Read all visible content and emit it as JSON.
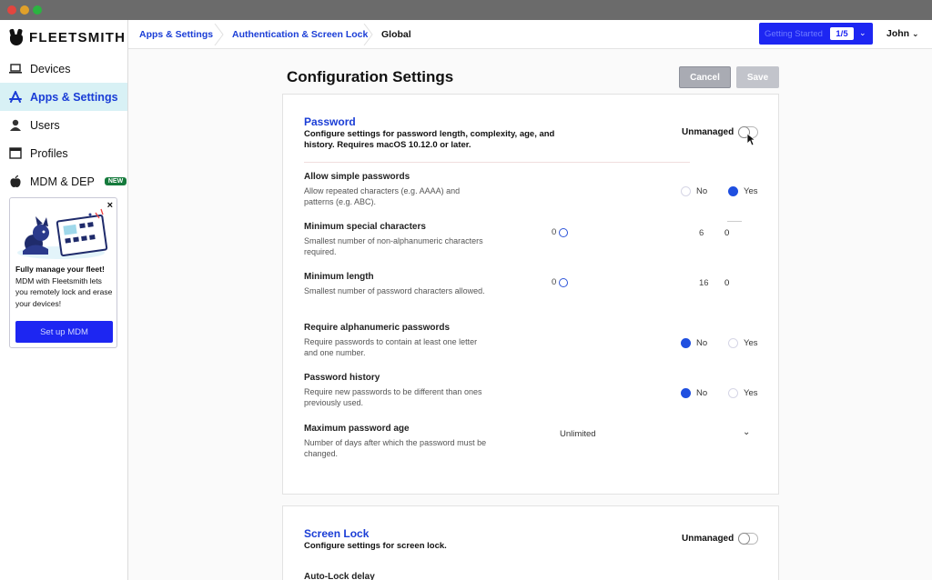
{
  "app": {
    "brand": "FLEETSMITH"
  },
  "sidebar": {
    "items": [
      {
        "label": "Devices",
        "icon": "laptop-icon"
      },
      {
        "label": "Apps & Settings",
        "icon": "app-store-icon",
        "active": true
      },
      {
        "label": "Users",
        "icon": "user-icon"
      },
      {
        "label": "Profiles",
        "icon": "profile-window-icon"
      },
      {
        "label": "MDM & DEP",
        "icon": "apple-icon",
        "badge": "NEW"
      }
    ],
    "promo": {
      "close": "×",
      "headline": "Fully manage your fleet!",
      "body": "MDM with Fleetsmith lets you remotely lock and erase your devices!",
      "button": "Set up MDM"
    }
  },
  "breadcrumb": {
    "items": [
      "Apps & Settings",
      "Authentication & Screen Lock",
      "Global"
    ]
  },
  "header": {
    "getting_started_label": "Getting Started",
    "getting_started_count": "1/5",
    "user": "John"
  },
  "main": {
    "title": "Configuration Settings",
    "cancel_label": "Cancel",
    "save_label": "Save",
    "password": {
      "title": "Password",
      "description": "Configure settings for password length, complexity, age, and history. Requires macOS 10.12.0 or later.",
      "managed_label": "Unmanaged",
      "settings": {
        "simple": {
          "label": "Allow simple passwords",
          "description": "Allow repeated characters (e.g. AAAA) and patterns (e.g. ABC).",
          "no": "No",
          "yes": "Yes",
          "selected": "yes"
        },
        "special": {
          "label": "Minimum special characters",
          "description": "Smallest number of non-alphanumeric characters required.",
          "min": "0",
          "max": "6",
          "value": "0"
        },
        "length": {
          "label": "Minimum length",
          "description": "Smallest number of password characters allowed.",
          "min": "0",
          "max": "16",
          "value": "0"
        },
        "alnum": {
          "label": "Require alphanumeric passwords",
          "description": "Require passwords to contain at least one letter and one number.",
          "no": "No",
          "yes": "Yes",
          "selected": "no"
        },
        "history": {
          "label": "Password history",
          "description": "Require new passwords to be different than ones previously used.",
          "no": "No",
          "yes": "Yes",
          "selected": "no"
        },
        "age": {
          "label": "Maximum password age",
          "description": "Number of days after which the password must be changed.",
          "value": "Unlimited"
        }
      }
    },
    "screen_lock": {
      "title": "Screen Lock",
      "description": "Configure settings for screen lock.",
      "managed_label": "Unmanaged",
      "first_setting": "Auto-Lock delay"
    }
  },
  "colors": {
    "accent": "#1a3dd6",
    "primary_button": "#1d26f2",
    "active_nav_bg": "#d8f1f5"
  }
}
